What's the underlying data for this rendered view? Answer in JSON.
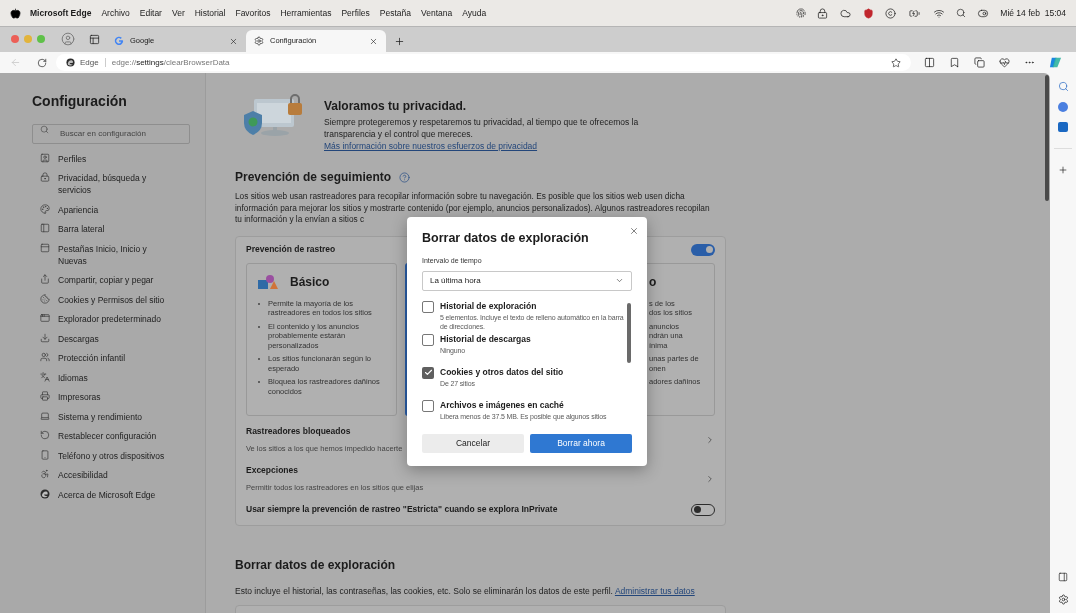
{
  "menu_bar": {
    "app": "Microsoft Edge",
    "menus": [
      "Archivo",
      "Editar",
      "Ver",
      "Historial",
      "Favoritos",
      "Herramientas",
      "Perfiles",
      "Pestaña",
      "Ventana",
      "Ayuda"
    ],
    "clock": "Mié 14 feb  15:04"
  },
  "tabs": [
    {
      "title": "Google",
      "selected": false
    },
    {
      "title": "Configuración",
      "selected": true
    }
  ],
  "address_bar": {
    "site": "Edge",
    "url": "edge://**settings**/clearBrowserData"
  },
  "sidebar": {
    "title": "Configuración",
    "search_placeholder": "Buscar en configuración",
    "items": [
      "Perfiles",
      "Privacidad, búsqueda y servicios",
      "Apariencia",
      "Barra lateral",
      "Pestañas Inicio, Inicio y Nuevas",
      "Compartir, copiar y pegar",
      "Cookies y Permisos del sitio",
      "Explorador predeterminado",
      "Descargas",
      "Protección infantil",
      "Idiomas",
      "Impresoras",
      "Sistema y rendimiento",
      "Restablecer configuración",
      "Teléfono y otros dispositivos",
      "Accesibilidad",
      "Acerca de Microsoft Edge"
    ]
  },
  "privacy_banner": {
    "title": "Valoramos tu privacidad.",
    "text": "Siempre protegeremos y respetaremos tu privacidad, al tiempo que te ofrecemos la transparencia y el control que mereces.",
    "link": "Más información sobre nuestros esfuerzos de privacidad"
  },
  "tracking": {
    "heading": "Prevención de seguimiento",
    "text": "Los sitios web usan rastreadores para recopilar información sobre tu navegación. Es posible que los sitios web usen dicha información para mejorar los sitios y mostrarte contenido (por ejemplo, anuncios personalizados). Algunos rastreadores recopilan tu información y la envían a sitios c",
    "panel_title": "Prevención de rastreo",
    "on": true,
    "levels": [
      {
        "title": "Básico",
        "selected": false,
        "bullets": [
          [
            "Permite la mayoría de los rastreadores en todos los sitios"
          ],
          [
            "El contenido y los anuncios probablemente estarán personalizados"
          ],
          [
            "Los sitios funcionarán según lo esperado"
          ],
          [
            "Bloquea los rastreadores dañinos conocidos"
          ]
        ]
      },
      {
        "selected": true
      },
      {
        "title": "o",
        "selected": false,
        "bullets": [
          [
            "s de los",
            "dos los sitios"
          ],
          [
            "anuncios",
            "ndrán una",
            "ínima"
          ],
          [
            "unas partes de",
            "onen"
          ],
          [
            "adores dañinos"
          ]
        ]
      }
    ],
    "rows": [
      {
        "title": "Rastreadores bloqueados",
        "description": "Ve los sitios a los que hemos impedido hacerte"
      },
      {
        "title": "Excepciones",
        "description": "Permitir todos los rastreadores en los sitios que elijas"
      }
    ],
    "inprivate": {
      "label": "Usar siempre la prevención de rastreo \"Estricta\" cuando se explora InPrivate",
      "on": false
    }
  },
  "clear_data": {
    "heading": "Borrar datos de exploración",
    "text": "Esto incluye el historial, las contraseñas, las cookies, etc. Solo se eliminarán los datos de este perfil.",
    "link": "Administrar tus datos"
  },
  "dialog": {
    "title": "Borrar datos de exploración",
    "range_label": "Intervalo de tiempo",
    "range_value": "La última hora",
    "items": [
      {
        "title": "Historial de exploración",
        "detail": "5 elementos. Incluye el texto de relleno automático en la barra de direcciones.",
        "checked": false
      },
      {
        "title": "Historial de descargas",
        "detail": "Ninguno",
        "checked": false
      },
      {
        "title": "Cookies y otros datos del sitio",
        "detail": "De 27 sitios",
        "checked": true
      },
      {
        "title": "Archivos e imágenes en caché",
        "detail": "Libera menos de 37.5 MB. Es posible que algunos sitios",
        "checked": false
      }
    ],
    "buttons": [
      {
        "label": "Cancelar",
        "kind": "secondary"
      },
      {
        "label": "Borrar ahora",
        "kind": "primary"
      }
    ]
  }
}
